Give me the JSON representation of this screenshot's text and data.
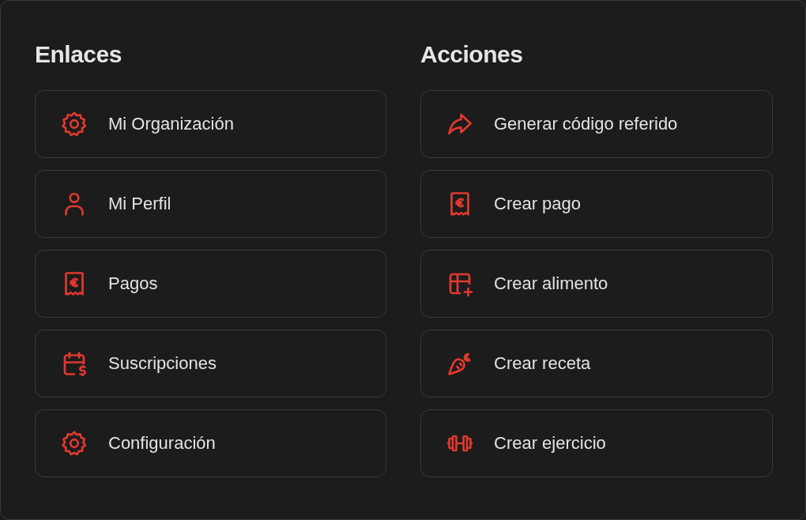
{
  "sections": [
    {
      "title": "Enlaces",
      "items": [
        {
          "label": "Mi Organización",
          "kind": "gear"
        },
        {
          "label": "Mi Perfil",
          "kind": "person"
        },
        {
          "label": "Pagos",
          "kind": "receipt"
        },
        {
          "label": "Suscripciones",
          "kind": "calendar"
        },
        {
          "label": "Configuración",
          "kind": "gear"
        }
      ]
    },
    {
      "title": "Acciones",
      "items": [
        {
          "label": "Generar código referido",
          "kind": "share"
        },
        {
          "label": "Crear pago",
          "kind": "receipt"
        },
        {
          "label": "Crear alimento",
          "kind": "table"
        },
        {
          "label": "Crear receta",
          "kind": "carrot"
        },
        {
          "label": "Crear ejercicio",
          "kind": "dumbbell"
        }
      ]
    }
  ]
}
